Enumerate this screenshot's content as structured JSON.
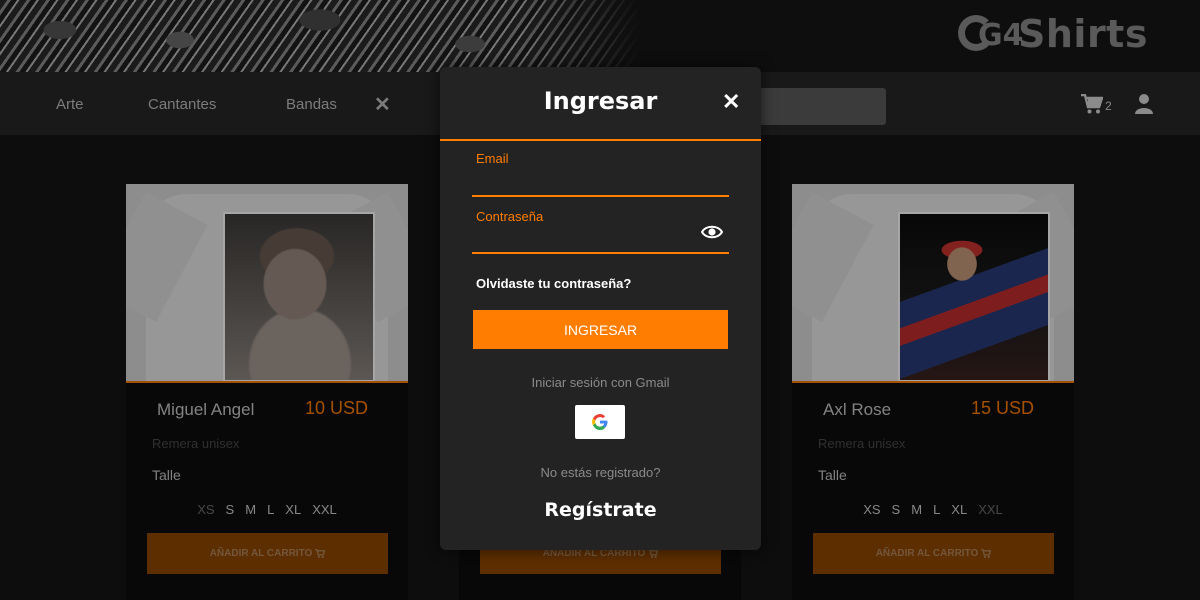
{
  "header": {
    "logo_text": "Shirts",
    "logo_mark": "G4"
  },
  "nav": {
    "links": [
      "Arte",
      "Cantantes",
      "Bandas"
    ],
    "close_icon": "close-icon",
    "cart_count": "2"
  },
  "products": [
    {
      "name": "Miguel Angel",
      "price": "10 USD",
      "type": "Remera unisex",
      "talle_label": "Talle",
      "sizes": [
        "XS",
        "S",
        "M",
        "L",
        "XL",
        "XXL"
      ],
      "button": "AÑADIR AL CARRITO"
    },
    {
      "button": "AÑADIR AL CARRITO"
    },
    {
      "name": "Axl Rose",
      "price": "15 USD",
      "type": "Remera unisex",
      "talle_label": "Talle",
      "sizes": [
        "XS",
        "S",
        "M",
        "L",
        "XL",
        "XXL"
      ],
      "button": "AÑADIR AL CARRITO"
    }
  ],
  "modal": {
    "title": "Ingresar",
    "email_label": "Email",
    "email_value": "",
    "password_label": "Contraseña",
    "password_value": "",
    "forgot": "Olvidaste tu contraseña?",
    "login_button": "INGRESAR",
    "gmail_label": "Iniciar sesión con Gmail",
    "not_registered": "No estás registrado?",
    "register": "Regístrate"
  },
  "colors": {
    "accent": "#ff7d00",
    "background": "#141414",
    "modal": "#232323",
    "navbar": "#272727"
  }
}
